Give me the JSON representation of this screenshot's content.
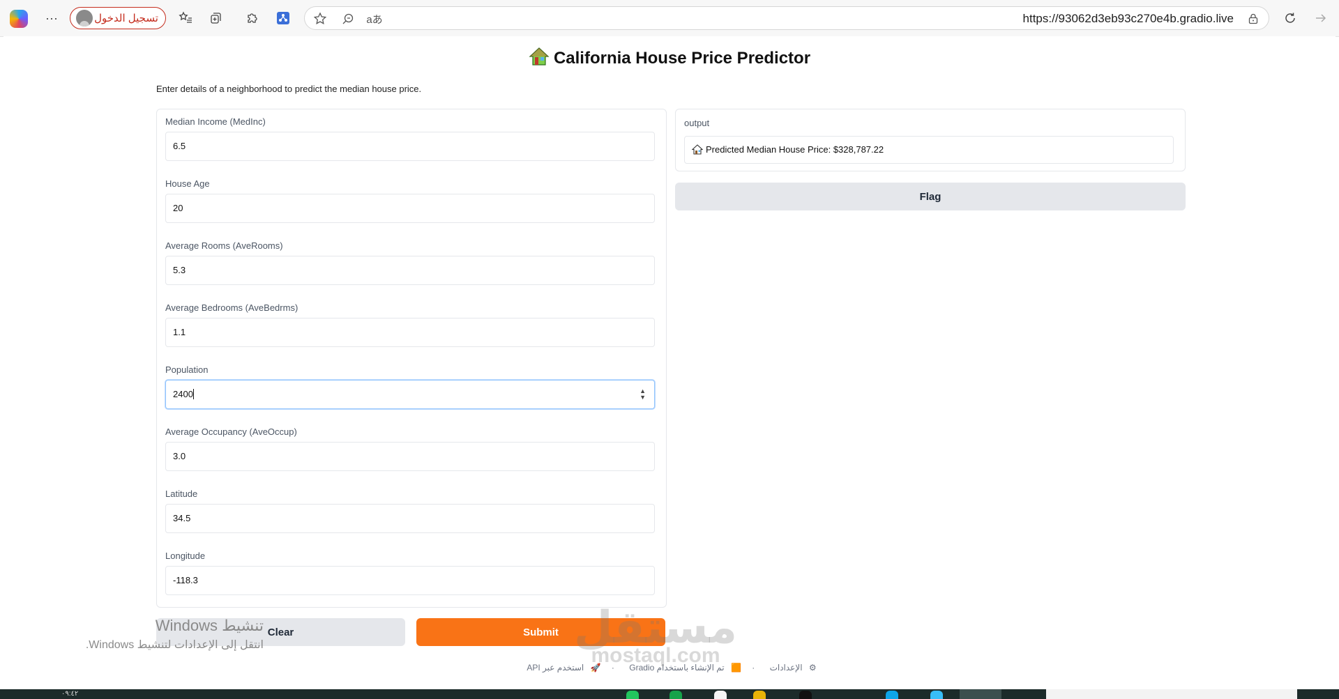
{
  "browser": {
    "signin_label": "تسجيل الدخول",
    "url": "https://93062d3eb93c270e4b.gradio.live",
    "icons": [
      "copilot-icon",
      "more-icon",
      "profile-icon",
      "favorites-icon",
      "collections-icon",
      "extensions-icon",
      "app-icon",
      "star-icon",
      "zoom-icon",
      "read-aloud-icon",
      "lock-icon",
      "refresh-icon",
      "forward-icon"
    ]
  },
  "app": {
    "title": "California House Price Predictor",
    "description": "Enter details of a neighborhood to predict the median house price.",
    "fields": [
      {
        "label": "Median Income (MedInc)",
        "value": "6.5"
      },
      {
        "label": "House Age",
        "value": "20"
      },
      {
        "label": "Average Rooms (AveRooms)",
        "value": "5.3"
      },
      {
        "label": "Average Bedrooms (AveBedrms)",
        "value": "1.1"
      },
      {
        "label": "Population",
        "value": "2400"
      },
      {
        "label": "Average Occupancy (AveOccup)",
        "value": "3.0"
      },
      {
        "label": "Latitude",
        "value": "34.5"
      },
      {
        "label": "Longitude",
        "value": "-118.3"
      }
    ],
    "output_label": "output",
    "output_value": "Predicted Median House Price: $328,787.22",
    "flag_label": "Flag",
    "clear_label": "Clear",
    "submit_label": "Submit",
    "footer": {
      "api": "استخدم عبر API",
      "built": "تم الإنشاء باستخدام Gradio",
      "settings": "الإعدادات"
    }
  },
  "overlay": {
    "activate_title": "تنشيط Windows",
    "activate_sub": "انتقل إلى الإعدادات لتنشيط Windows.",
    "watermark_ar": "مستقل",
    "watermark_lat": "mostaql.com"
  },
  "taskbar": {
    "clock": "٠٩:٤٢"
  },
  "colors": {
    "accent": "#f97316",
    "signin": "#c42b1c",
    "focus": "#93c5fd"
  }
}
